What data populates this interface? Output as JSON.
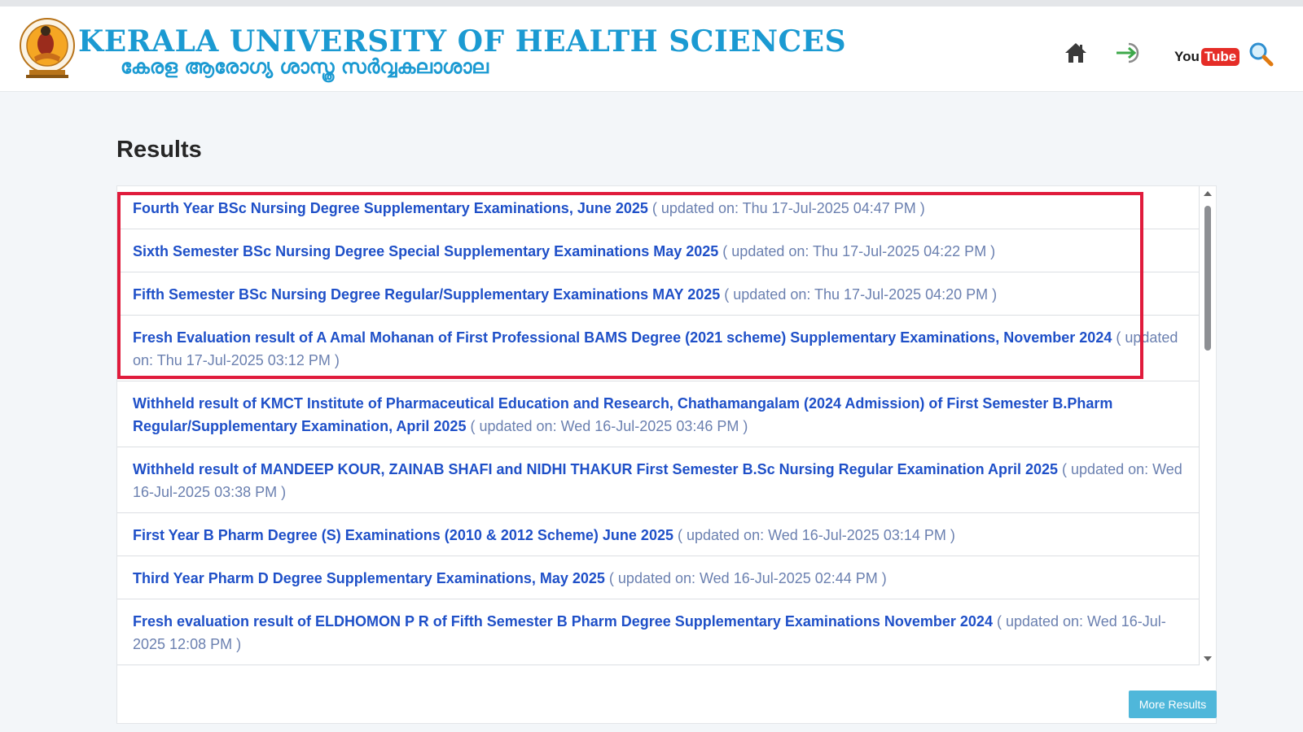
{
  "header": {
    "title_en": "KERALA UNIVERSITY OF HEALTH SCIENCES",
    "title_ml": "കേരള ആരോഗ്യ ശാസ്ത്ര സർവ്വകലാശാല",
    "logo_icon": "university-seal-logo",
    "icons": [
      "home-icon",
      "login-icon",
      "youtube-icon",
      "search-icon"
    ],
    "youtube_you": "You",
    "youtube_tube": "Tube"
  },
  "colors": {
    "brand": "#1b9ad2",
    "link": "#1f50c8",
    "muted": "#6b80b0",
    "highlight": "#e01b3c",
    "button": "#4fb7da"
  },
  "results": {
    "title": "Results",
    "items": [
      {
        "title": "Fourth Year BSc Nursing Degree Supplementary Examinations, June 2025",
        "updated": "( updated on: Thu 17-Jul-2025 04:47 PM )"
      },
      {
        "title": "Sixth Semester BSc Nursing Degree Special Supplementary Examinations May 2025",
        "updated": "( updated on: Thu 17-Jul-2025 04:22 PM )"
      },
      {
        "title": "Fifth Semester BSc Nursing Degree Regular/Supplementary Examinations MAY 2025",
        "updated": "( updated on: Thu 17-Jul-2025 04:20 PM )"
      },
      {
        "title": "Fresh Evaluation result of A Amal Mohanan of First Professional BAMS Degree (2021 scheme) Supplementary Examinations, November 2024",
        "updated": "( updated on: Thu 17-Jul-2025 03:12 PM )"
      },
      {
        "title": "Withheld result of KMCT Institute of Pharmaceutical Education and Research, Chathamangalam (2024 Admission) of First Semester B.Pharm Regular/Supplementary Examination, April 2025",
        "updated": "( updated on: Wed 16-Jul-2025 03:46 PM )"
      },
      {
        "title": "Withheld result of MANDEEP KOUR, ZAINAB SHAFI and NIDHI THAKUR First Semester B.Sc Nursing Regular Examination April 2025",
        "updated": "( updated on: Wed 16-Jul-2025 03:38 PM )"
      },
      {
        "title": "First Year B Pharm Degree (S) Examinations (2010 & 2012 Scheme) June 2025",
        "updated": "( updated on: Wed 16-Jul-2025 03:14 PM )"
      },
      {
        "title": "Third Year Pharm D Degree Supplementary Examinations, May 2025",
        "updated": "( updated on: Wed 16-Jul-2025 02:44 PM )"
      },
      {
        "title": "Fresh evaluation result of ELDHOMON P R of Fifth Semester B Pharm Degree Supplementary Examinations November 2024",
        "updated": "( updated on: Wed 16-Jul-2025 12:08 PM )"
      }
    ],
    "more_button": "More Results"
  }
}
